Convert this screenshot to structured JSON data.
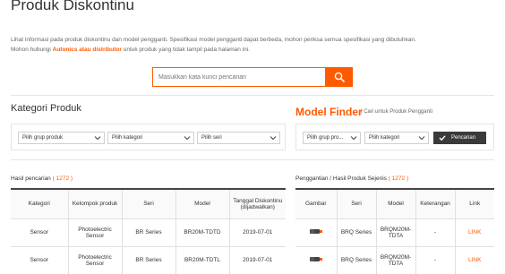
{
  "page_title": "Produk Diskontinu",
  "intro": {
    "line1": "Lihat informasi pada produk diskontinu dan model pengganti. Spesifikasi model pengganti dapat berbeda, mohon periksa semua spesifikasi yang dibutuhkan.",
    "line2_prefix": "Mohon hubungi ",
    "line2_link": "Autonics atau distributor",
    "line2_suffix": " untuk produk yang tidak tampil pada halaman ini."
  },
  "search": {
    "placeholder": "Masukkan kata kunci pencarian"
  },
  "kategori": {
    "title": "Kategori Produk",
    "selects": [
      {
        "value": "Pilih grup produk"
      },
      {
        "value": "Pilih kategori"
      },
      {
        "value": "Pilih seri"
      }
    ]
  },
  "model_finder": {
    "title": "Model Finder",
    "subtitle": "| Cari untuk Produk Pengganti",
    "selects": [
      {
        "value": "Pilih grup pro..."
      },
      {
        "value": "Pilih kategori"
      }
    ],
    "button_label": "Pencarian"
  },
  "results": {
    "label": "Hasil pencarian",
    "count_text": "( 1272 )",
    "headers": [
      "Kategori",
      "Kelompok produk",
      "Seri",
      "Model",
      "Tanggal Diskontinu (dijadwalkan)"
    ],
    "rows": [
      [
        "Sensor",
        "Photoelectric Sensor",
        "BR Series",
        "BR20M-TDTD",
        "2019-07-01"
      ],
      [
        "Sensor",
        "Photoelectric Sensor",
        "BR Series",
        "BR20M-TDTL",
        "2019-07-01"
      ]
    ]
  },
  "replacements": {
    "label": "Penggantian / Hasil Produk Sejenis",
    "count_text": "( 1272 )",
    "headers": [
      "Gambar",
      "Seri",
      "Model",
      "Keterangan",
      "Link"
    ],
    "rows": [
      [
        "BRQ Series",
        "BRQM20M-TDTA",
        "-",
        "LINK"
      ],
      [
        "BRQ Series",
        "BRQM20M-TDTA",
        "-",
        "LINK"
      ]
    ]
  },
  "colors": {
    "accent": "#ff5a00",
    "dark_button": "#3a3a3a"
  },
  "icons": {
    "search": "search-icon",
    "select": "chevron-down-icon",
    "find": "checkmark-icon",
    "product": "sensor-image"
  }
}
